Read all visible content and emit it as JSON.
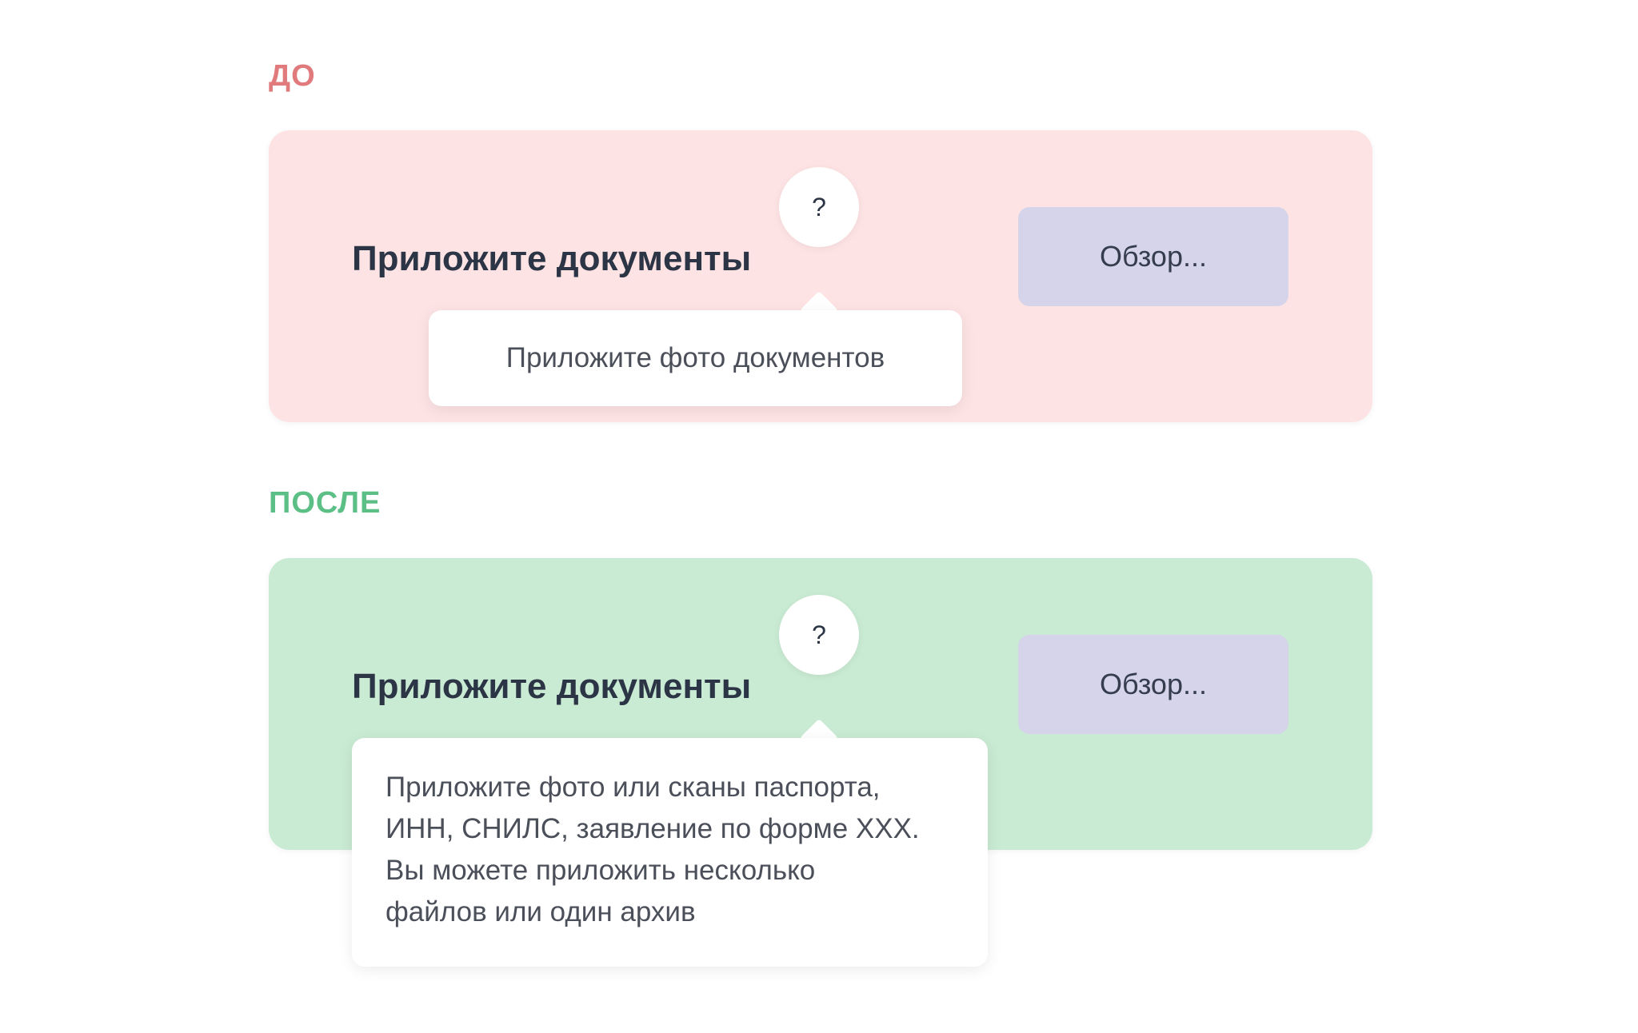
{
  "before": {
    "label": "ДО",
    "title": "Приложите документы",
    "help_icon": "?",
    "browse_label": "Обзор...",
    "tooltip": "Приложите фото документов"
  },
  "after": {
    "label": "ПОСЛЕ",
    "title": "Приложите документы",
    "help_icon": "?",
    "browse_label": "Обзор...",
    "tooltip_lines": [
      "Приложите фото или сканы паспорта,",
      "ИНН, СНИЛС, заявление по форме ХХХ.",
      "Вы можете приложить несколько",
      "файлов или один архив"
    ]
  },
  "colors": {
    "before_label": "#e07a7c",
    "before_panel": "#fde3e3",
    "after_label": "#5cbf85",
    "after_panel": "#c9ead3",
    "button_bg": "#d5d4ea",
    "title_text": "#2c3545"
  }
}
